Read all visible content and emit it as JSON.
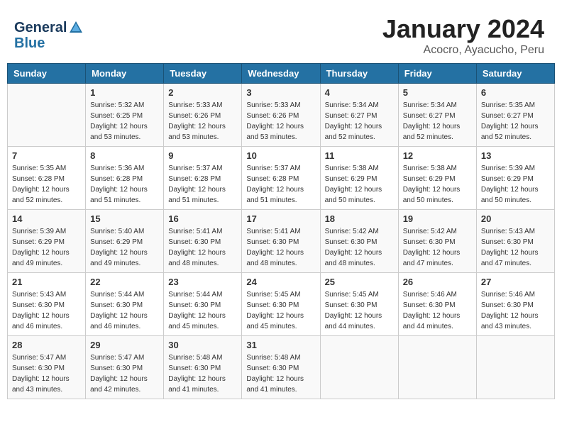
{
  "header": {
    "logo_line1": "General",
    "logo_line2": "Blue",
    "month": "January 2024",
    "location": "Acocro, Ayacucho, Peru"
  },
  "weekdays": [
    "Sunday",
    "Monday",
    "Tuesday",
    "Wednesday",
    "Thursday",
    "Friday",
    "Saturday"
  ],
  "weeks": [
    [
      {
        "day": "",
        "sunrise": "",
        "sunset": "",
        "daylight": ""
      },
      {
        "day": "1",
        "sunrise": "Sunrise: 5:32 AM",
        "sunset": "Sunset: 6:25 PM",
        "daylight": "Daylight: 12 hours and 53 minutes."
      },
      {
        "day": "2",
        "sunrise": "Sunrise: 5:33 AM",
        "sunset": "Sunset: 6:26 PM",
        "daylight": "Daylight: 12 hours and 53 minutes."
      },
      {
        "day": "3",
        "sunrise": "Sunrise: 5:33 AM",
        "sunset": "Sunset: 6:26 PM",
        "daylight": "Daylight: 12 hours and 53 minutes."
      },
      {
        "day": "4",
        "sunrise": "Sunrise: 5:34 AM",
        "sunset": "Sunset: 6:27 PM",
        "daylight": "Daylight: 12 hours and 52 minutes."
      },
      {
        "day": "5",
        "sunrise": "Sunrise: 5:34 AM",
        "sunset": "Sunset: 6:27 PM",
        "daylight": "Daylight: 12 hours and 52 minutes."
      },
      {
        "day": "6",
        "sunrise": "Sunrise: 5:35 AM",
        "sunset": "Sunset: 6:27 PM",
        "daylight": "Daylight: 12 hours and 52 minutes."
      }
    ],
    [
      {
        "day": "7",
        "sunrise": "Sunrise: 5:35 AM",
        "sunset": "Sunset: 6:28 PM",
        "daylight": "Daylight: 12 hours and 52 minutes."
      },
      {
        "day": "8",
        "sunrise": "Sunrise: 5:36 AM",
        "sunset": "Sunset: 6:28 PM",
        "daylight": "Daylight: 12 hours and 51 minutes."
      },
      {
        "day": "9",
        "sunrise": "Sunrise: 5:37 AM",
        "sunset": "Sunset: 6:28 PM",
        "daylight": "Daylight: 12 hours and 51 minutes."
      },
      {
        "day": "10",
        "sunrise": "Sunrise: 5:37 AM",
        "sunset": "Sunset: 6:28 PM",
        "daylight": "Daylight: 12 hours and 51 minutes."
      },
      {
        "day": "11",
        "sunrise": "Sunrise: 5:38 AM",
        "sunset": "Sunset: 6:29 PM",
        "daylight": "Daylight: 12 hours and 50 minutes."
      },
      {
        "day": "12",
        "sunrise": "Sunrise: 5:38 AM",
        "sunset": "Sunset: 6:29 PM",
        "daylight": "Daylight: 12 hours and 50 minutes."
      },
      {
        "day": "13",
        "sunrise": "Sunrise: 5:39 AM",
        "sunset": "Sunset: 6:29 PM",
        "daylight": "Daylight: 12 hours and 50 minutes."
      }
    ],
    [
      {
        "day": "14",
        "sunrise": "Sunrise: 5:39 AM",
        "sunset": "Sunset: 6:29 PM",
        "daylight": "Daylight: 12 hours and 49 minutes."
      },
      {
        "day": "15",
        "sunrise": "Sunrise: 5:40 AM",
        "sunset": "Sunset: 6:29 PM",
        "daylight": "Daylight: 12 hours and 49 minutes."
      },
      {
        "day": "16",
        "sunrise": "Sunrise: 5:41 AM",
        "sunset": "Sunset: 6:30 PM",
        "daylight": "Daylight: 12 hours and 48 minutes."
      },
      {
        "day": "17",
        "sunrise": "Sunrise: 5:41 AM",
        "sunset": "Sunset: 6:30 PM",
        "daylight": "Daylight: 12 hours and 48 minutes."
      },
      {
        "day": "18",
        "sunrise": "Sunrise: 5:42 AM",
        "sunset": "Sunset: 6:30 PM",
        "daylight": "Daylight: 12 hours and 48 minutes."
      },
      {
        "day": "19",
        "sunrise": "Sunrise: 5:42 AM",
        "sunset": "Sunset: 6:30 PM",
        "daylight": "Daylight: 12 hours and 47 minutes."
      },
      {
        "day": "20",
        "sunrise": "Sunrise: 5:43 AM",
        "sunset": "Sunset: 6:30 PM",
        "daylight": "Daylight: 12 hours and 47 minutes."
      }
    ],
    [
      {
        "day": "21",
        "sunrise": "Sunrise: 5:43 AM",
        "sunset": "Sunset: 6:30 PM",
        "daylight": "Daylight: 12 hours and 46 minutes."
      },
      {
        "day": "22",
        "sunrise": "Sunrise: 5:44 AM",
        "sunset": "Sunset: 6:30 PM",
        "daylight": "Daylight: 12 hours and 46 minutes."
      },
      {
        "day": "23",
        "sunrise": "Sunrise: 5:44 AM",
        "sunset": "Sunset: 6:30 PM",
        "daylight": "Daylight: 12 hours and 45 minutes."
      },
      {
        "day": "24",
        "sunrise": "Sunrise: 5:45 AM",
        "sunset": "Sunset: 6:30 PM",
        "daylight": "Daylight: 12 hours and 45 minutes."
      },
      {
        "day": "25",
        "sunrise": "Sunrise: 5:45 AM",
        "sunset": "Sunset: 6:30 PM",
        "daylight": "Daylight: 12 hours and 44 minutes."
      },
      {
        "day": "26",
        "sunrise": "Sunrise: 5:46 AM",
        "sunset": "Sunset: 6:30 PM",
        "daylight": "Daylight: 12 hours and 44 minutes."
      },
      {
        "day": "27",
        "sunrise": "Sunrise: 5:46 AM",
        "sunset": "Sunset: 6:30 PM",
        "daylight": "Daylight: 12 hours and 43 minutes."
      }
    ],
    [
      {
        "day": "28",
        "sunrise": "Sunrise: 5:47 AM",
        "sunset": "Sunset: 6:30 PM",
        "daylight": "Daylight: 12 hours and 43 minutes."
      },
      {
        "day": "29",
        "sunrise": "Sunrise: 5:47 AM",
        "sunset": "Sunset: 6:30 PM",
        "daylight": "Daylight: 12 hours and 42 minutes."
      },
      {
        "day": "30",
        "sunrise": "Sunrise: 5:48 AM",
        "sunset": "Sunset: 6:30 PM",
        "daylight": "Daylight: 12 hours and 41 minutes."
      },
      {
        "day": "31",
        "sunrise": "Sunrise: 5:48 AM",
        "sunset": "Sunset: 6:30 PM",
        "daylight": "Daylight: 12 hours and 41 minutes."
      },
      {
        "day": "",
        "sunrise": "",
        "sunset": "",
        "daylight": ""
      },
      {
        "day": "",
        "sunrise": "",
        "sunset": "",
        "daylight": ""
      },
      {
        "day": "",
        "sunrise": "",
        "sunset": "",
        "daylight": ""
      }
    ]
  ]
}
